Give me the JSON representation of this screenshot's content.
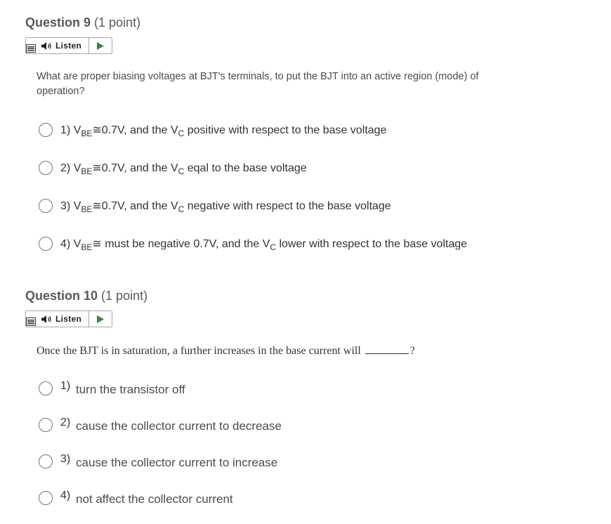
{
  "q9": {
    "title": "Question 9",
    "points": "(1 point)",
    "listen_label": "Listen",
    "prompt": "What are proper biasing voltages at BJT's terminals, to put the BJT into an active region (mode) of operation?",
    "options": [
      {
        "num": "1)",
        "v": "V",
        "be": "BE",
        "mid": "≅0.7V, and the V",
        "c": "C",
        "rest": " positive with respect to the base voltage"
      },
      {
        "num": "2)",
        "v": "V",
        "be": "BE",
        "mid": "≅0.7V, and the V",
        "c": "C",
        "rest": " eqal to the base voltage"
      },
      {
        "num": "3)",
        "v": "V",
        "be": "BE",
        "mid": "≅0.7V, and the V",
        "c": "C",
        "rest": " negative with respect to the base voltage"
      },
      {
        "num": "4)",
        "v": "V",
        "be": "BE",
        "mid": "≅ must be negative 0.7V, and the V",
        "c": "C",
        "rest": " lower with respect to the base voltage"
      }
    ]
  },
  "q10": {
    "title": "Question 10",
    "points": "(1 point)",
    "listen_label": "Listen",
    "prompt_before": "Once the BJT is in saturation, a further increases in the base current will",
    "prompt_after": "?",
    "options": [
      {
        "num": "1)",
        "text": "turn the transistor off"
      },
      {
        "num": "2)",
        "text": "cause the collector current to decrease"
      },
      {
        "num": "3)",
        "text": "cause the collector current to increase"
      },
      {
        "num": "4)",
        "text": "not affect the collector current"
      }
    ]
  },
  "icons": {
    "menu": "menu-icon",
    "speaker": "speaker-icon",
    "play": "play-icon",
    "play_color": "#2e8b3e"
  }
}
